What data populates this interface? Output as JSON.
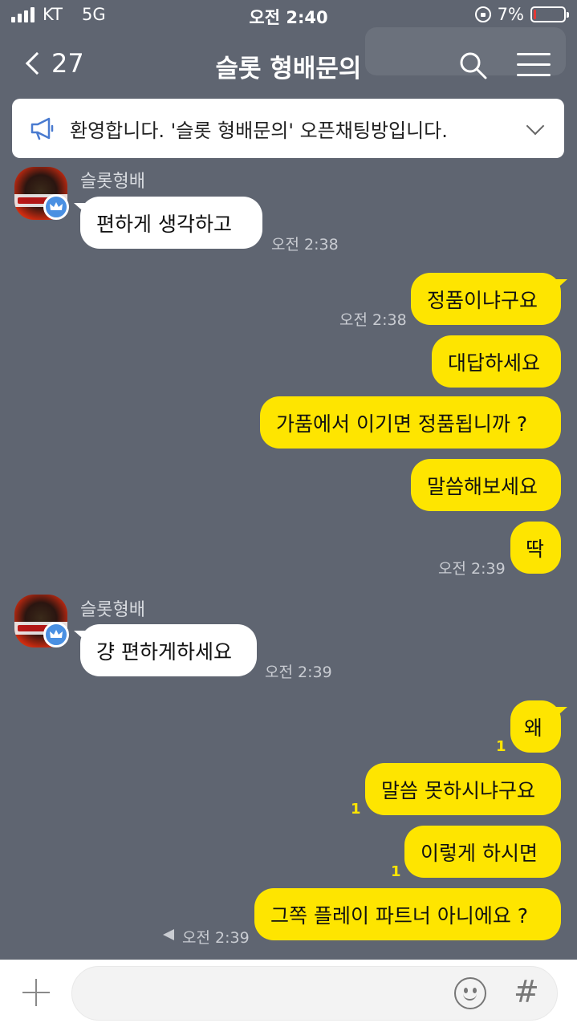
{
  "status_bar": {
    "carrier": "KT",
    "network": "5G",
    "time": "오전 2:40",
    "battery_text": "7%",
    "battery_level": 0.07,
    "battery_color": "#e53935"
  },
  "header": {
    "back_count": "27",
    "title": "슬롯 형배문의",
    "icons": [
      "chevron-left-icon",
      "search-icon",
      "menu-icon"
    ]
  },
  "notice": {
    "text": "환영합니다. '슬롯 형배문의' 오픈채팅방입니다.",
    "icon": "megaphone-icon"
  },
  "colors": {
    "background": "#5f6571",
    "outgoing_bubble": "#fee500",
    "incoming_bubble": "#ffffff",
    "unread": "#fee500"
  },
  "messages": [
    {
      "direction": "in",
      "sender": "슬롯형배",
      "text": "편하게 생각하고",
      "time": "오전 2:38"
    },
    {
      "direction": "out",
      "text": "정품이냐구요",
      "time": "오전 2:38"
    },
    {
      "direction": "out",
      "text": "대답하세요"
    },
    {
      "direction": "out",
      "text": "가품에서 이기면 정품됩니까 ?"
    },
    {
      "direction": "out",
      "text": "말씀해보세요"
    },
    {
      "direction": "out",
      "text": "딱",
      "time": "오전 2:39"
    },
    {
      "direction": "in",
      "sender": "슬롯형배",
      "text": "걍 편하게하세요",
      "time": "오전 2:39"
    },
    {
      "direction": "out",
      "text": "왜",
      "unread": "1"
    },
    {
      "direction": "out",
      "text": "말씀 못하시냐구요",
      "unread": "1"
    },
    {
      "direction": "out",
      "text": "이렇게 하시면",
      "unread": "1"
    },
    {
      "direction": "out",
      "text": "그쪽 플레이 파트너 아니에요 ?",
      "time": "오전 2:39",
      "sending": true
    }
  ],
  "input_bar": {
    "icons": [
      "plus-icon",
      "emoji-icon",
      "hashtag-icon"
    ],
    "hash_symbol": "#"
  }
}
